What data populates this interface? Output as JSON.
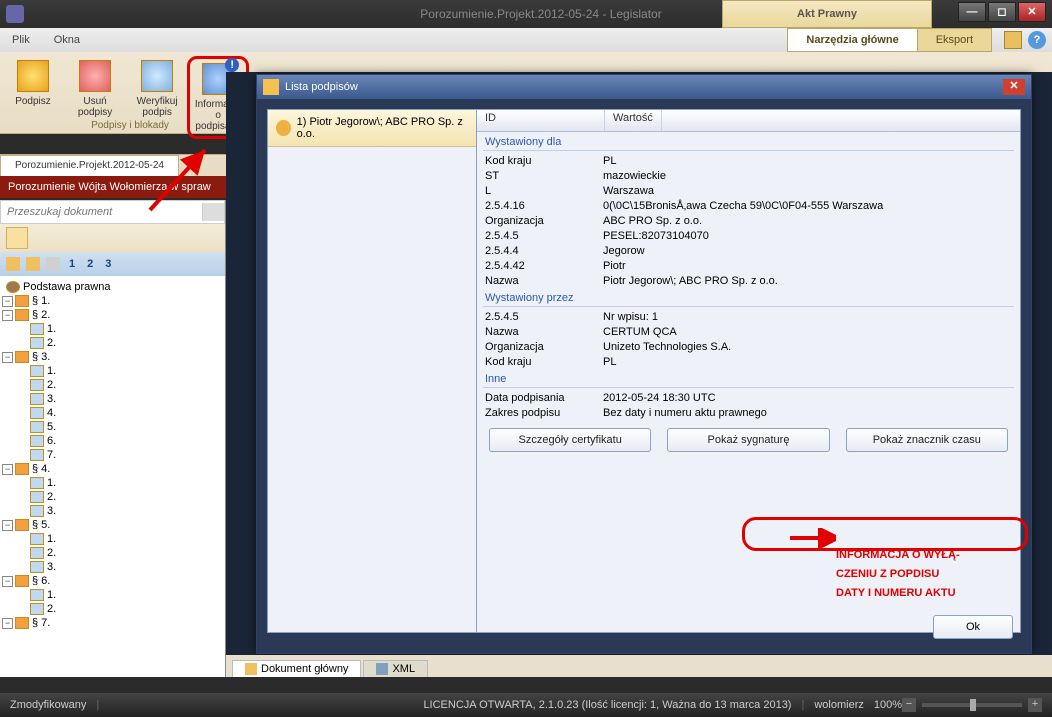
{
  "title": "Porozumienie.Projekt.2012-05-24 - Legislator",
  "toprighttab": "Akt Prawny",
  "menu": {
    "plik": "Plik",
    "okna": "Okna"
  },
  "righttabs": {
    "main": "Narzędzia główne",
    "export": "Eksport"
  },
  "ribbon": {
    "podpisz": "Podpisz",
    "usun": "Usuń podpisy",
    "weryfikuj": "Weryfikuj\npodpis",
    "info": "Informacje\no podpisach",
    "grouplabel": "Podpisy i blokady"
  },
  "doctab": "Porozumienie.Projekt.2012-05-24",
  "redbanner": "Porozumienie Wójta Wołomierza w spraw",
  "search_placeholder": "Przeszukaj dokument",
  "tree": {
    "root": "Podstawa prawna",
    "s1": "§ 1.",
    "s2": "§ 2.",
    "s3": "§ 3.",
    "s4": "§ 4.",
    "s5": "§ 5.",
    "s6": "§ 6.",
    "s7": "§ 7.",
    "i1": "1.",
    "i2": "2.",
    "i3": "3.",
    "i4": "4.",
    "i5": "5.",
    "i6": "6.",
    "i7": "7."
  },
  "nums": {
    "n1": "1",
    "n2": "2",
    "n3": "3"
  },
  "bottomtabs": {
    "main": "Dokument główny",
    "xml": "XML"
  },
  "dialog": {
    "title": "Lista podpisów",
    "sigitem": "1) Piotr Jegorow\\; ABC PRO Sp. z o.o.",
    "col_id": "ID",
    "col_val": "Wartość",
    "sec1": "Wystawiony dla",
    "sec2": "Wystawiony przez",
    "sec3": "Inne",
    "rows1": [
      {
        "k": "Kod kraju",
        "v": "PL"
      },
      {
        "k": "ST",
        "v": "mazowieckie"
      },
      {
        "k": "L",
        "v": "Warszawa"
      },
      {
        "k": "2.5.4.16",
        "v": "0(\\0C\\15BronisÅ‚awa Czecha 59\\0C\\0F04-555 Warszawa"
      },
      {
        "k": "Organizacja",
        "v": "ABC PRO Sp. z o.o."
      },
      {
        "k": "2.5.4.5",
        "v": "PESEL:82073104070"
      },
      {
        "k": "2.5.4.4",
        "v": "Jegorow"
      },
      {
        "k": "2.5.4.42",
        "v": "Piotr"
      },
      {
        "k": "Nazwa",
        "v": "Piotr Jegorow\\; ABC PRO Sp. z o.o."
      }
    ],
    "rows2": [
      {
        "k": "2.5.4.5",
        "v": "Nr wpisu: 1"
      },
      {
        "k": "Nazwa",
        "v": "CERTUM QCA"
      },
      {
        "k": "Organizacja",
        "v": "Unizeto Technologies S.A."
      },
      {
        "k": "Kod kraju",
        "v": "PL"
      }
    ],
    "rows3": [
      {
        "k": "Data podpisania",
        "v": "2012-05-24 18:30 UTC"
      },
      {
        "k": "Zakres podpisu",
        "v": "Bez daty i numeru aktu prawnego"
      }
    ],
    "btn_cert": "Szczegóły certyfikatu",
    "btn_sig": "Pokaż sygnaturę",
    "btn_time": "Pokaż znacznik czasu",
    "ok": "Ok"
  },
  "annotation": "INFORMACJA O WYŁĄ-\nCZENIU Z POPDISU\nDATY I NUMERU AKTU",
  "status": {
    "mod": "Zmodyfikowany",
    "lic": "LICENCJA OTWARTA, 2.1.0.23 (Ilość licencji: 1, Ważna do 13 marca 2013)",
    "user": "wolomierz",
    "zoom": "100%"
  }
}
